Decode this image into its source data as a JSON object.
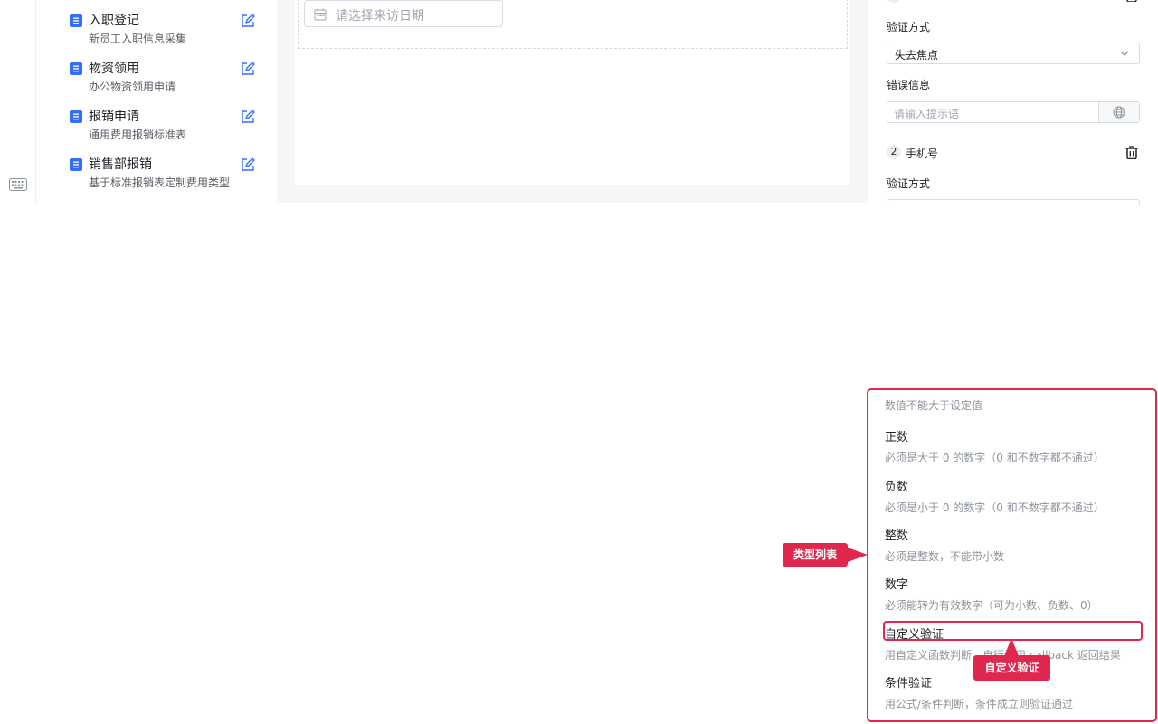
{
  "forms": [
    {
      "title": "入职登记",
      "desc": "新员工入职信息采集"
    },
    {
      "title": "物资领用",
      "desc": "办公物资领用申请"
    },
    {
      "title": "报销申请",
      "desc": "通用费用报销标准表"
    },
    {
      "title": "销售部报销",
      "desc": "基于标准报销表定制费用类型"
    }
  ],
  "canvas": {
    "date_placeholder": "请选择来访日期"
  },
  "props": {
    "validate_label": "验证方式",
    "validate_value": "失去焦点",
    "error_label": "错误信息",
    "error_placeholder": "请输入提示语",
    "rule2_number": "2",
    "rule2_name": "手机号",
    "validate_label_2": "验证方式"
  },
  "dropdown": {
    "top_desc": "数值不能大于设定值",
    "options": [
      {
        "title": "正数",
        "desc": "必须是大于 0 的数字（0 和不数字都不通过）"
      },
      {
        "title": "负数",
        "desc": "必须是小于 0 的数字（0 和不数字都不通过）"
      },
      {
        "title": "整数",
        "desc": "必须是整数，不能带小数"
      },
      {
        "title": "数字",
        "desc": "必须能转为有效数字（可为小数、负数、0）"
      },
      {
        "title": "自定义验证",
        "desc": "用自定义函数判断，自行调用 callback 返回结果"
      },
      {
        "title": "条件验证",
        "desc": "用公式/条件判断，条件成立则验证通过"
      }
    ]
  },
  "annotations": {
    "type_list": "类型列表",
    "custom_validation": "自定义验证"
  },
  "colors": {
    "accent": "#e0284f",
    "link": "#3370ff"
  }
}
